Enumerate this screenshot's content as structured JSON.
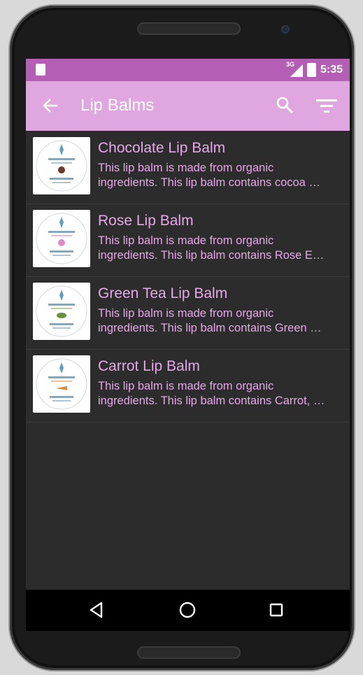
{
  "status_bar": {
    "time": "5:35",
    "network": "3G",
    "left_icon": "sd-card-icon",
    "right_icons": [
      "signal-icon",
      "battery-icon"
    ],
    "color": "#b45eb6"
  },
  "toolbar": {
    "title": "Lip Balms",
    "back_icon": "arrow-back-icon",
    "search_icon": "search-icon",
    "filter_icon": "filter-icon",
    "color": "#e0a6e0"
  },
  "products": [
    {
      "name": "Chocolate Lip Balm",
      "desc_line1": "This lip balm is made from organic",
      "desc_line2": "ingredients. This lip balm contains cocoa …",
      "accent": "#6b3b2a"
    },
    {
      "name": "Rose Lip Balm",
      "desc_line1": "This lip balm is made from organic",
      "desc_line2": "ingredients. This lip balm contains Rose E…",
      "accent": "#e28bc2"
    },
    {
      "name": "Green Tea Lip Balm",
      "desc_line1": "This lip balm is made from organic",
      "desc_line2": "ingredients. This lip balm contains Green …",
      "accent": "#6a8f3a"
    },
    {
      "name": "Carrot Lip Balm",
      "desc_line1": "This lip balm is made from organic",
      "desc_line2": "ingredients. This lip balm contains Carrot, …",
      "accent": "#e08a3a"
    }
  ],
  "text_color": "#e6a8e8",
  "background": "#2c2c2c",
  "navbar": {
    "icons": [
      "nav-back-icon",
      "nav-home-icon",
      "nav-recents-icon"
    ]
  }
}
